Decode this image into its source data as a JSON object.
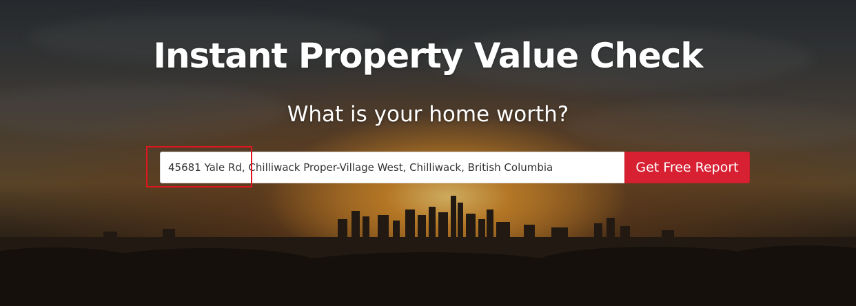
{
  "hero": {
    "title": "Instant Property Value Check",
    "subtitle": "What is your home worth?",
    "background_image": "sunset-city-skyline"
  },
  "search": {
    "address_value": "45681 Yale Rd, Chilliwack Proper-Village West, Chilliwack, British Columbia",
    "submit_label": "Get Free Report"
  },
  "colors": {
    "accent": "#d72032",
    "highlight": "#e0161e"
  }
}
